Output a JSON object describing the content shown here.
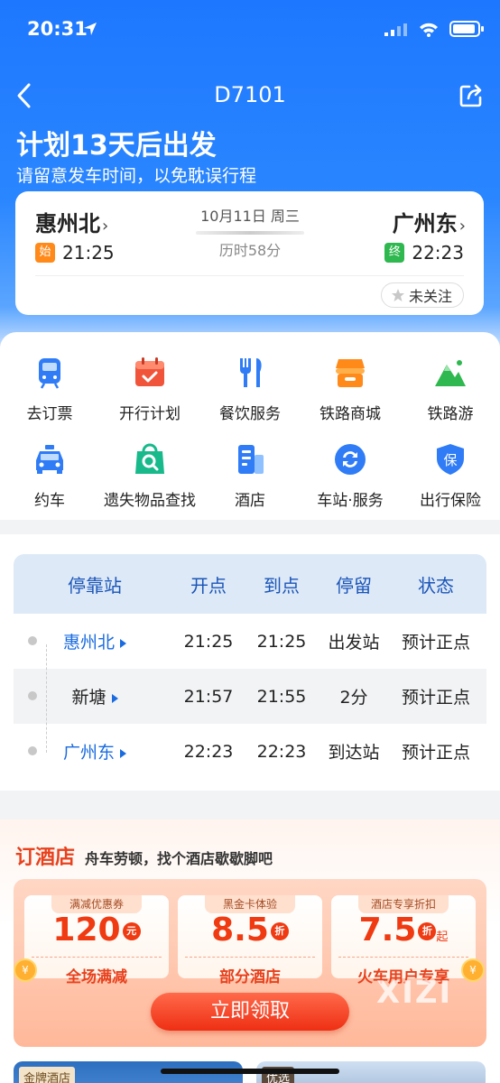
{
  "status_bar": {
    "time": "20:31"
  },
  "nav": {
    "title": "D7101"
  },
  "plan": {
    "title": "计划13天后出发",
    "subtitle": "请留意发车时间，以免耽误行程"
  },
  "trip": {
    "from": "惠州北",
    "to": "广州东",
    "date": "10月11日 周三",
    "duration": "历时58分",
    "dep_tag": "始",
    "dep_time": "21:25",
    "arr_tag": "终",
    "arr_time": "22:23",
    "follow_label": "未关注"
  },
  "services": [
    {
      "label": "去订票",
      "icon": "ticket-icon",
      "color": "#2f7cf6"
    },
    {
      "label": "开行计划",
      "icon": "calendar-icon",
      "color": "#f0553c"
    },
    {
      "label": "餐饮服务",
      "icon": "dining-icon",
      "color": "#2f7cf6"
    },
    {
      "label": "铁路商城",
      "icon": "shop-icon",
      "color": "#ff8a1a"
    },
    {
      "label": "铁路游",
      "icon": "mountain-icon",
      "color": "#2fb84f"
    },
    {
      "label": "约车",
      "icon": "taxi-icon",
      "color": "#2f7cf6"
    },
    {
      "label": "遗失物品查找",
      "icon": "lost-bag-icon",
      "color": "#18b98a"
    },
    {
      "label": "酒店",
      "icon": "hotel-icon",
      "color": "#2f7cf6"
    },
    {
      "label": "车站·服务",
      "icon": "station-service-icon",
      "color": "#2f7cf6"
    },
    {
      "label": "出行保险",
      "icon": "insurance-icon",
      "color": "#2f7cf6"
    }
  ],
  "timetable": {
    "headers": [
      "停靠站",
      "开点",
      "到点",
      "停留",
      "状态"
    ],
    "rows": [
      {
        "station": "惠州北",
        "depart": "21:25",
        "arrive": "21:25",
        "stay": "出发站",
        "status": "预计正点"
      },
      {
        "station": "新塘",
        "depart": "21:57",
        "arrive": "21:55",
        "stay": "2分",
        "status": "预计正点"
      },
      {
        "station": "广州东",
        "depart": "22:23",
        "arrive": "22:23",
        "stay": "到达站",
        "status": "预计正点"
      }
    ]
  },
  "hotel": {
    "title": "订酒店",
    "subtitle": "舟车劳顿，找个酒店歇歇脚吧",
    "coupons": [
      {
        "kind": "满减优惠券",
        "amount": "120",
        "unit": "元",
        "suffix": "",
        "scope": "全场满减"
      },
      {
        "kind": "黑金卡体验",
        "amount": "8.5",
        "unit": "折",
        "suffix": "",
        "scope": "部分酒店"
      },
      {
        "kind": "酒店专享折扣",
        "amount": "7.5",
        "unit": "折",
        "suffix": "起",
        "scope": "火车用户专享"
      }
    ],
    "claim_label": "立即领取",
    "watermark": "XIZI",
    "thumb_badges": [
      "金牌酒店",
      "优选"
    ]
  },
  "colors": {
    "primary": "#1e78ff",
    "accent": "#ef3a12"
  }
}
